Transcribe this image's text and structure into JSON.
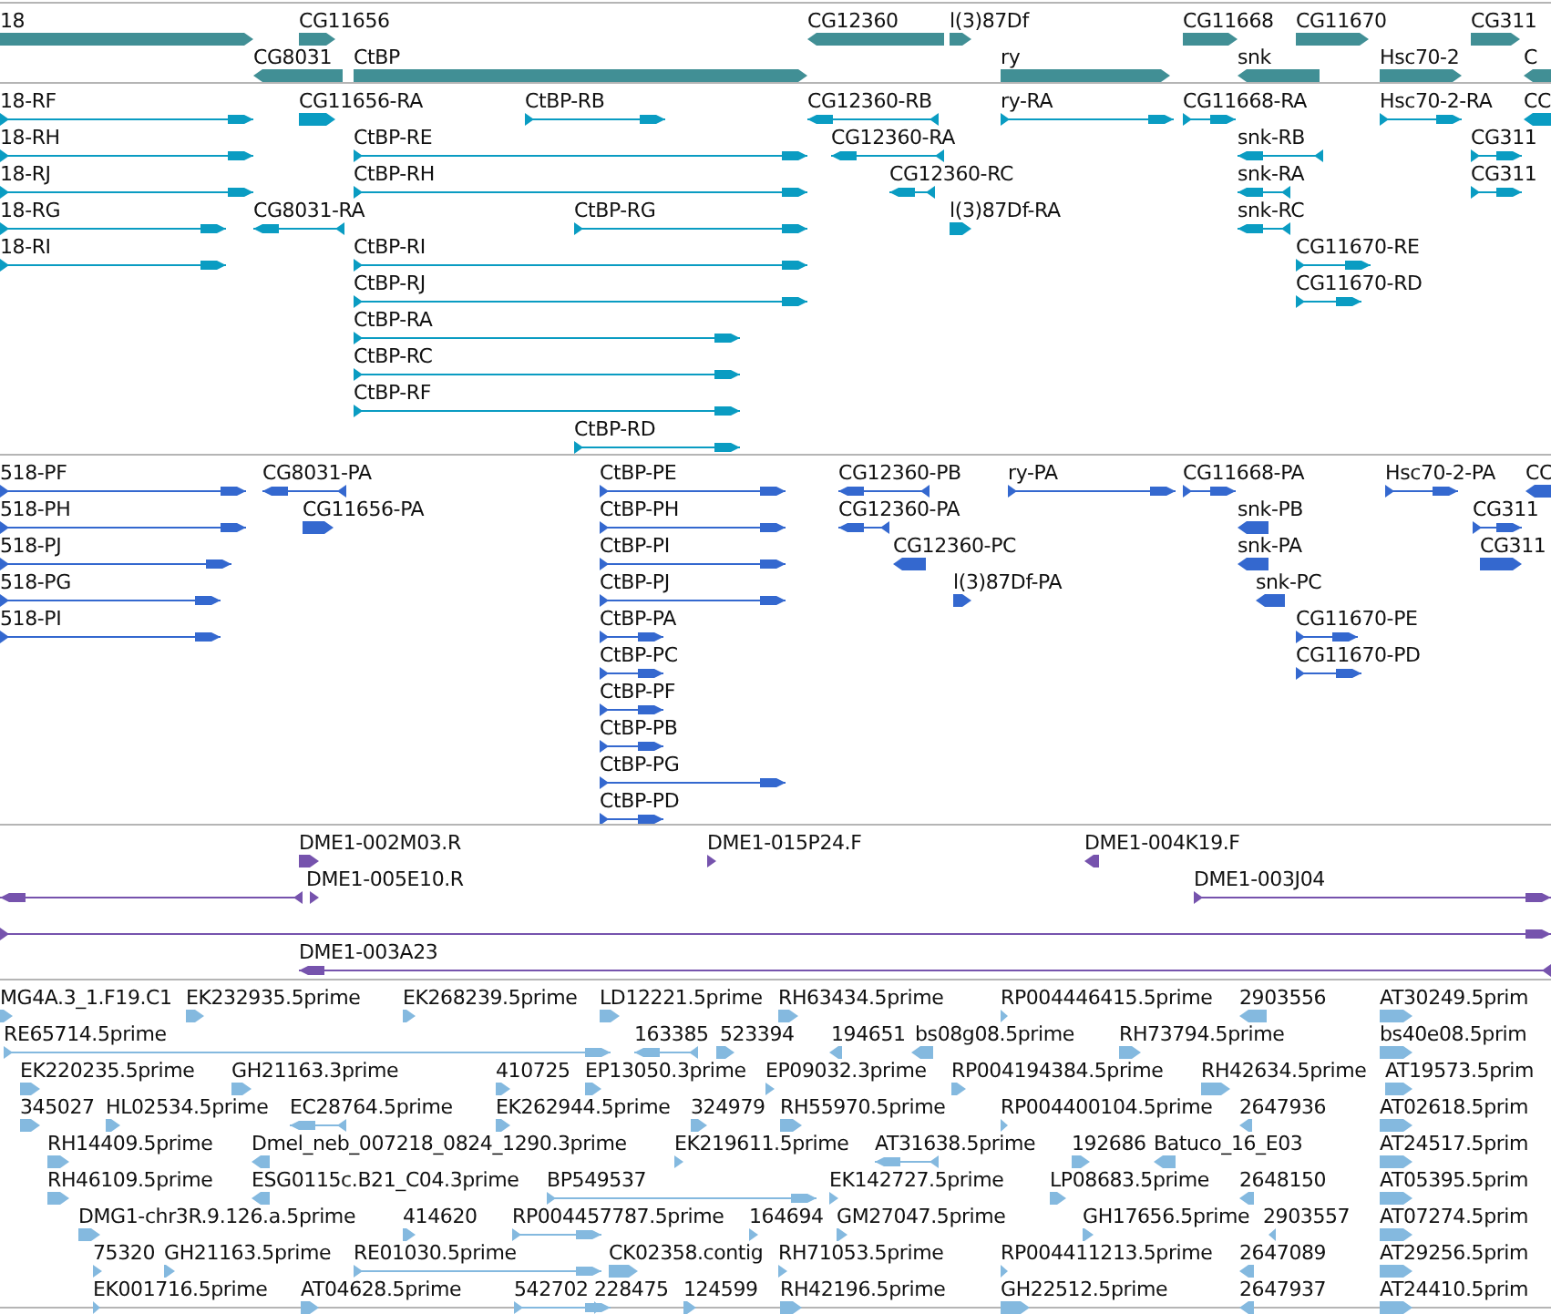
{
  "tracks": [
    {
      "kind": "gene",
      "features": [
        {
          "label": "18",
          "reverse": false
        },
        {
          "label": "CG11656",
          "reverse": false
        },
        {
          "label": "CG12360",
          "reverse": true
        },
        {
          "label": "l(3)87Df",
          "reverse": false
        },
        {
          "label": "CG11668",
          "reverse": false
        },
        {
          "label": "CG11670",
          "reverse": false
        },
        {
          "label": "CG311",
          "reverse": false
        },
        {
          "label": "CG8031",
          "reverse": true
        },
        {
          "label": "CtBP",
          "reverse": false
        },
        {
          "label": "ry",
          "reverse": false
        },
        {
          "label": "snk",
          "reverse": true
        },
        {
          "label": "Hsc70-2",
          "reverse": false
        },
        {
          "label": "C",
          "reverse": true
        }
      ]
    },
    {
      "kind": "transcript",
      "features": [
        {
          "label": "18-RF",
          "reverse": false
        },
        {
          "label": "CG11656-RA",
          "reverse": false
        },
        {
          "label": "CtBP-RB",
          "reverse": false
        },
        {
          "label": "CG12360-RB",
          "reverse": true
        },
        {
          "label": "ry-RA",
          "reverse": false
        },
        {
          "label": "CG11668-RA",
          "reverse": false
        },
        {
          "label": "Hsc70-2-RA",
          "reverse": false
        },
        {
          "label": "CC",
          "reverse": true
        },
        {
          "label": "18-RH",
          "reverse": false
        },
        {
          "label": "CtBP-RE",
          "reverse": false
        },
        {
          "label": "CG12360-RA",
          "reverse": true
        },
        {
          "label": "snk-RB",
          "reverse": true
        },
        {
          "label": "CG311",
          "reverse": false
        },
        {
          "label": "18-RJ",
          "reverse": false
        },
        {
          "label": "CtBP-RH",
          "reverse": false
        },
        {
          "label": "CG12360-RC",
          "reverse": true
        },
        {
          "label": "snk-RA",
          "reverse": true
        },
        {
          "label": "CG311",
          "reverse": false
        },
        {
          "label": "18-RG",
          "reverse": false
        },
        {
          "label": "CG8031-RA",
          "reverse": true
        },
        {
          "label": "CtBP-RG",
          "reverse": false
        },
        {
          "label": "l(3)87Df-RA",
          "reverse": false
        },
        {
          "label": "snk-RC",
          "reverse": true
        },
        {
          "label": "18-RI",
          "reverse": false
        },
        {
          "label": "CtBP-RI",
          "reverse": false
        },
        {
          "label": "CG11670-RE",
          "reverse": false
        },
        {
          "label": "CtBP-RJ",
          "reverse": false
        },
        {
          "label": "CG11670-RD",
          "reverse": false
        },
        {
          "label": "CtBP-RA",
          "reverse": false
        },
        {
          "label": "CtBP-RC",
          "reverse": false
        },
        {
          "label": "CtBP-RF",
          "reverse": false
        },
        {
          "label": "CtBP-RD",
          "reverse": false
        }
      ]
    },
    {
      "kind": "protein",
      "features": [
        {
          "label": "518-PF",
          "reverse": false
        },
        {
          "label": "CG8031-PA",
          "reverse": true
        },
        {
          "label": "CtBP-PE",
          "reverse": false
        },
        {
          "label": "CG12360-PB",
          "reverse": true
        },
        {
          "label": "ry-PA",
          "reverse": false
        },
        {
          "label": "CG11668-PA",
          "reverse": false
        },
        {
          "label": "Hsc70-2-PA",
          "reverse": false
        },
        {
          "label": "CC",
          "reverse": true
        },
        {
          "label": "518-PH",
          "reverse": false
        },
        {
          "label": "CG11656-PA",
          "reverse": false
        },
        {
          "label": "CtBP-PH",
          "reverse": false
        },
        {
          "label": "CG12360-PA",
          "reverse": true
        },
        {
          "label": "snk-PB",
          "reverse": true
        },
        {
          "label": "CG311",
          "reverse": false
        },
        {
          "label": "518-PJ",
          "reverse": false
        },
        {
          "label": "CtBP-PI",
          "reverse": false
        },
        {
          "label": "CG12360-PC",
          "reverse": true
        },
        {
          "label": "snk-PA",
          "reverse": true
        },
        {
          "label": "CG311",
          "reverse": false
        },
        {
          "label": "518-PG",
          "reverse": false
        },
        {
          "label": "CtBP-PJ",
          "reverse": false
        },
        {
          "label": "l(3)87Df-PA",
          "reverse": false
        },
        {
          "label": "snk-PC",
          "reverse": true
        },
        {
          "label": "518-PI",
          "reverse": false
        },
        {
          "label": "CtBP-PA",
          "reverse": false
        },
        {
          "label": "CG11670-PE",
          "reverse": false
        },
        {
          "label": "CtBP-PC",
          "reverse": false
        },
        {
          "label": "CG11670-PD",
          "reverse": false
        },
        {
          "label": "CtBP-PF",
          "reverse": false
        },
        {
          "label": "CtBP-PB",
          "reverse": false
        },
        {
          "label": "CtBP-PG",
          "reverse": false
        },
        {
          "label": "CtBP-PD",
          "reverse": false
        }
      ]
    },
    {
      "kind": "clone",
      "features": [
        {
          "label": "DME1-002M03.R",
          "reverse": false
        },
        {
          "label": "DME1-015P24.F",
          "reverse": false
        },
        {
          "label": "DME1-004K19.F",
          "reverse": true
        },
        {
          "reverse": true
        },
        {
          "label": "DME1-005E10.R",
          "reverse": false
        },
        {
          "label": "DME1-003J04",
          "reverse": false
        },
        {
          "reverse": false
        },
        {
          "label": "DME1-003A23",
          "reverse": true
        }
      ]
    },
    {
      "kind": "est",
      "features": [
        {
          "label": "MG4A.3_1.F19.C1",
          "reverse": false
        },
        {
          "label": "EK232935.5prime",
          "reverse": false
        },
        {
          "label": "EK268239.5prime",
          "reverse": false
        },
        {
          "label": "LD12221.5prime",
          "reverse": false
        },
        {
          "label": "RH63434.5prime",
          "reverse": false
        },
        {
          "label": "RP004446415.5prime",
          "reverse": false
        },
        {
          "label": "2903556",
          "reverse": true
        },
        {
          "label": "AT30249.5prim",
          "reverse": false
        },
        {
          "label": "RE65714.5prime",
          "reverse": false
        },
        {
          "label": "163385",
          "reverse": true
        },
        {
          "label": "523394",
          "reverse": false
        },
        {
          "label": "194651",
          "reverse": true
        },
        {
          "label": "bs08g08.5prime",
          "reverse": true
        },
        {
          "label": "RH73794.5prime",
          "reverse": false
        },
        {
          "label": "bs40e08.5prim",
          "reverse": false
        },
        {
          "label": "EK220235.5prime",
          "reverse": false
        },
        {
          "label": "GH21163.3prime",
          "reverse": false
        },
        {
          "label": "410725",
          "reverse": false
        },
        {
          "label": "EP13050.3prime",
          "reverse": false
        },
        {
          "label": "EP09032.3prime",
          "reverse": false
        },
        {
          "label": "RP004194384.5prime",
          "reverse": false
        },
        {
          "label": "RH42634.5prime",
          "reverse": false
        },
        {
          "label": "AT19573.5prim",
          "reverse": false
        },
        {
          "label": "345027",
          "reverse": false
        },
        {
          "label": "HL02534.5prime",
          "reverse": false
        },
        {
          "label": "EC28764.5prime",
          "reverse": true
        },
        {
          "label": "EK262944.5prime",
          "reverse": false
        },
        {
          "label": "324979",
          "reverse": false
        },
        {
          "label": "RH55970.5prime",
          "reverse": false
        },
        {
          "label": "RP004400104.5prime",
          "reverse": false
        },
        {
          "label": "2647936",
          "reverse": true
        },
        {
          "label": "AT02618.5prim",
          "reverse": false
        },
        {
          "label": "RH14409.5prime",
          "reverse": false
        },
        {
          "label": "Dmel_neb_007218_0824_1290.3prime",
          "reverse": true
        },
        {
          "label": "EK219611.5prime",
          "reverse": false
        },
        {
          "label": "AT31638.5prime",
          "reverse": true
        },
        {
          "label": "192686",
          "reverse": false
        },
        {
          "label": "Batuco_16_E03",
          "reverse": true
        },
        {
          "label": "AT24517.5prim",
          "reverse": false
        },
        {
          "label": "RH46109.5prime",
          "reverse": false
        },
        {
          "label": "ESG0115c.B21_C04.3prime",
          "reverse": true
        },
        {
          "label": "BP549537",
          "reverse": false
        },
        {
          "label": "EK142727.5prime",
          "reverse": false
        },
        {
          "label": "LP08683.5prime",
          "reverse": false
        },
        {
          "label": "2648150",
          "reverse": true
        },
        {
          "label": "AT05395.5prim",
          "reverse": false
        },
        {
          "label": "DMG1-chr3R.9.126.a.5prime",
          "reverse": false
        },
        {
          "label": "414620",
          "reverse": false
        },
        {
          "label": "RP004457787.5prime",
          "reverse": false
        },
        {
          "label": "164694",
          "reverse": false
        },
        {
          "label": "GM27047.5prime",
          "reverse": false
        },
        {
          "label": "GH17656.5prime",
          "reverse": false
        },
        {
          "label": "2903557",
          "reverse": true
        },
        {
          "label": "AT07274.5prim",
          "reverse": false
        },
        {
          "label": "75320",
          "reverse": false
        },
        {
          "label": "GH21163.5prime",
          "reverse": false
        },
        {
          "label": "RE01030.5prime",
          "reverse": false
        },
        {
          "label": "CK02358.contig",
          "reverse": false
        },
        {
          "label": "RH71053.5prime",
          "reverse": false
        },
        {
          "label": "RP004411213.5prime",
          "reverse": false
        },
        {
          "label": "2647089",
          "reverse": true
        },
        {
          "label": "AT29256.5prim",
          "reverse": false
        },
        {
          "label": "EK001716.5prime",
          "reverse": false
        },
        {
          "label": "AT04628.5prime",
          "reverse": false
        },
        {
          "label": "542702",
          "reverse": false
        },
        {
          "label": "228475",
          "reverse": false
        },
        {
          "label": "124599",
          "reverse": false
        },
        {
          "label": "RH42196.5prime",
          "reverse": false
        },
        {
          "label": "GH22512.5prime",
          "reverse": false
        },
        {
          "label": "2647937",
          "reverse": true
        },
        {
          "label": "AT24410.5prim",
          "reverse": false
        }
      ]
    }
  ]
}
